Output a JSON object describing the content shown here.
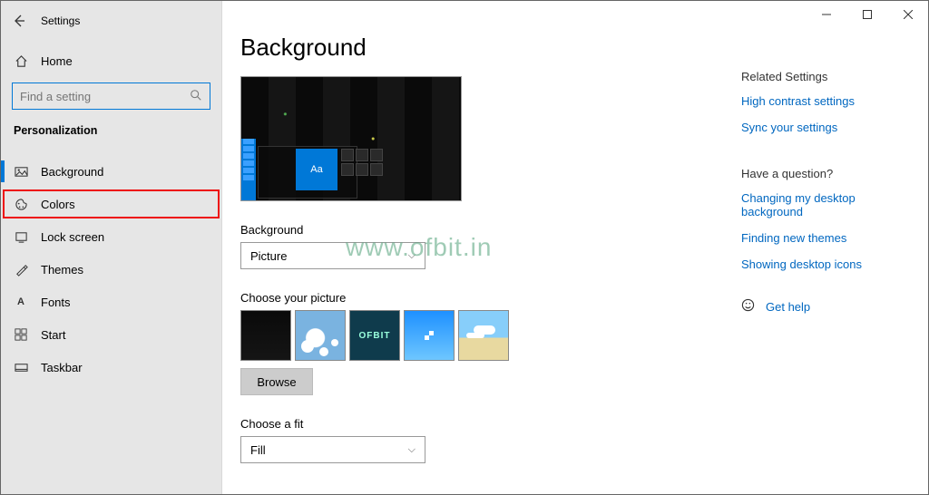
{
  "window": {
    "title": "Settings"
  },
  "sidebar": {
    "home": "Home",
    "search_placeholder": "Find a setting",
    "section": "Personalization",
    "items": [
      {
        "id": "background",
        "label": "Background"
      },
      {
        "id": "colors",
        "label": "Colors"
      },
      {
        "id": "lockscreen",
        "label": "Lock screen"
      },
      {
        "id": "themes",
        "label": "Themes"
      },
      {
        "id": "fonts",
        "label": "Fonts"
      },
      {
        "id": "start",
        "label": "Start"
      },
      {
        "id": "taskbar",
        "label": "Taskbar"
      }
    ]
  },
  "main": {
    "title": "Background",
    "preview_accent_text": "Aa",
    "background_label": "Background",
    "background_value": "Picture",
    "choose_picture_label": "Choose your picture",
    "thumb3_text": "OFBIT",
    "browse_label": "Browse",
    "choose_fit_label": "Choose a fit",
    "choose_fit_value": "Fill"
  },
  "right": {
    "related_header": "Related Settings",
    "links1": [
      "High contrast settings",
      "Sync your settings"
    ],
    "question_header": "Have a question?",
    "links2": [
      "Changing my desktop background",
      "Finding new themes",
      "Showing desktop icons"
    ],
    "get_help": "Get help"
  },
  "watermark": "www.ofbit.in"
}
